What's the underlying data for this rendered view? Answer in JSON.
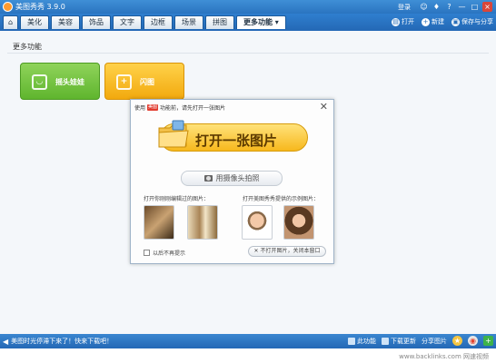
{
  "window": {
    "title": "美图秀秀 3.9.0",
    "user_label": "登录",
    "controls": [
      "☺",
      "♦",
      "?",
      "—",
      "□",
      "×"
    ]
  },
  "tabs": {
    "home_icon": "⌂",
    "items": [
      "美化",
      "美容",
      "饰品",
      "文字",
      "边框",
      "场景",
      "拼图"
    ],
    "more": "更多功能 ▾",
    "actions": [
      {
        "icon": "open-icon",
        "label": "打开"
      },
      {
        "icon": "new-icon",
        "label": "新建"
      },
      {
        "icon": "save-icon",
        "label": "保存与分享"
      }
    ]
  },
  "content": {
    "section_title": "更多功能",
    "features": [
      {
        "label": "摇头娃娃",
        "icon": "doll-icon"
      },
      {
        "label": "闪图",
        "icon": "flash-icon"
      }
    ]
  },
  "dialog": {
    "tip_prefix": "使用",
    "tip_badge": "美图",
    "tip_text": "功能前，请先打开一张图片",
    "close": "✕",
    "open_button": "打开一张图片",
    "camera_button": "用摄像头拍照",
    "recent_label": "打开你刚刚编辑过的图片：",
    "sample_label": "打开美图秀秀提供的示例图片：",
    "dont_show": "以后不再提示",
    "close_open": "✕ 不打开图片，关闭本窗口"
  },
  "status": {
    "speaker": "◀",
    "message": "美图时光停滞下来了！快来下载吧！",
    "items": [
      "此功能",
      "下载更新",
      "分享图片"
    ],
    "round_icons": [
      "★",
      "◉",
      "+"
    ]
  },
  "footer": {
    "watermark": "www.backlinks.com 网速视频"
  },
  "colors": {
    "titlebar": "#2a74c0",
    "green_feature": "#6bbd38",
    "orange_feature": "#f5b21a",
    "open_button": "#f7b81d"
  }
}
